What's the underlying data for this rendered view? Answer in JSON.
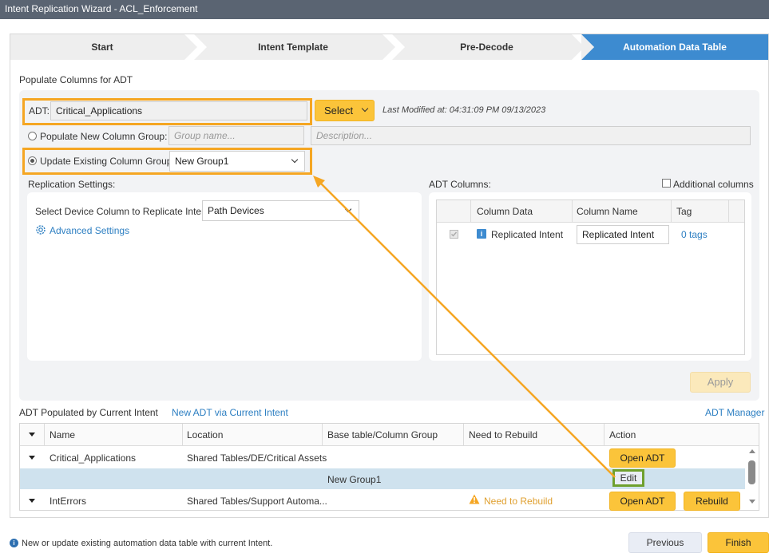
{
  "window": {
    "title": "Intent Replication Wizard - ACL_Enforcement"
  },
  "steps": [
    {
      "label": "Start"
    },
    {
      "label": "Intent Template"
    },
    {
      "label": "Pre-Decode"
    },
    {
      "label": "Automation Data Table"
    }
  ],
  "populate": {
    "section_title": "Populate Columns for ADT",
    "adt_label": "ADT:",
    "adt_value": "Critical_Applications",
    "select_button": "Select",
    "last_modified": "Last Modified at: 04:31:09 PM 09/13/2023",
    "new_group_label": "Populate New Column Group:",
    "group_name_placeholder": "Group name...",
    "description_placeholder": "Description...",
    "update_group_label": "Update Existing Column Group:",
    "update_group_value": "New Group1"
  },
  "replication": {
    "title": "Replication Settings:",
    "device_column_label": "Select Device Column to Replicate Intent:",
    "device_column_value": "Path Devices",
    "advanced_settings": "Advanced Settings"
  },
  "adt_columns": {
    "title": "ADT Columns:",
    "additional_columns": "Additional columns",
    "headers": [
      "Column Data",
      "Column Name",
      "Tag"
    ],
    "rows": [
      {
        "data": "Replicated Intent",
        "name": "Replicated Intent",
        "tag": "0 tags"
      }
    ],
    "apply": "Apply"
  },
  "populated": {
    "title": "ADT Populated by Current Intent",
    "new_adt_link": "New ADT via Current Intent",
    "manager_link": "ADT Manager",
    "headers": [
      "Name",
      "Location",
      "Base table/Column Group",
      "Need to Rebuild",
      "Action"
    ],
    "rows": [
      {
        "name": "Critical_Applications",
        "location": "Shared Tables/DE/Critical Assets",
        "base": "",
        "rebuild": "",
        "action": "Open ADT"
      },
      {
        "name": "",
        "location": "",
        "base": "New Group1",
        "rebuild": "",
        "action": "Edit"
      },
      {
        "name": "IntErrors",
        "location": "Shared Tables/Support Automa...",
        "base": "",
        "rebuild": "Need to Rebuild",
        "action": "Open ADT",
        "action2": "Rebuild"
      }
    ]
  },
  "footer": {
    "info": "New or update existing automation data table with current Intent.",
    "previous": "Previous",
    "finish": "Finish"
  },
  "colors": {
    "accent": "#3d8bd0",
    "highlight": "#f5a623",
    "button": "#fbc43a",
    "edit_border": "#6fa02e"
  }
}
